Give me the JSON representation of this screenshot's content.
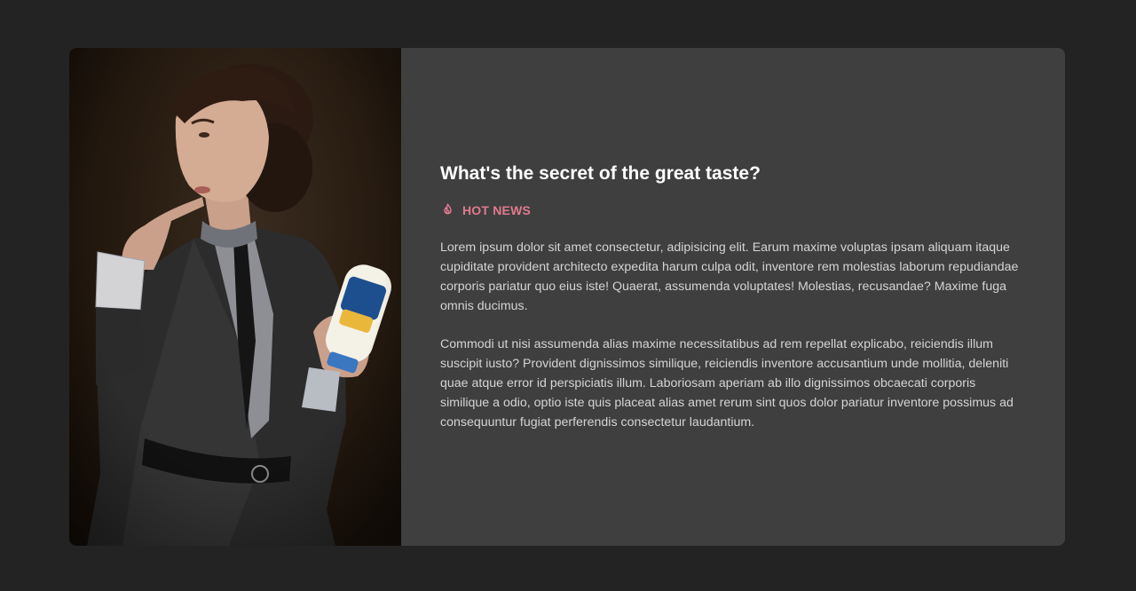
{
  "article": {
    "title": "What's the secret of the great taste?",
    "tag_label": "HOT NEWS",
    "tag_icon": "flame-icon",
    "paragraphs": [
      "Lorem ipsum dolor sit amet consectetur, adipisicing elit. Earum maxime voluptas ipsam aliquam itaque cupiditate provident architecto expedita harum culpa odit, inventore rem molestias laborum repudiandae corporis pariatur quo eius iste! Quaerat, assumenda voluptates! Molestias, recusandae? Maxime fuga omnis ducimus.",
      "Commodi ut nisi assumenda alias maxime necessitatibus ad rem repellat explicabo, reiciendis illum suscipit iusto? Provident dignissimos similique, reiciendis inventore accusantium unde mollitia, deleniti quae atque error id perspiciatis illum. Laboriosam aperiam ab illo dignissimos obcaecati corporis similique a odio, optio iste quis placeat alias amet rerum sint quos dolor pariatur inventore possimus ad consequuntur fugiat perferendis consectetur laudantium."
    ]
  },
  "colors": {
    "page_background": "#232323",
    "card_background": "#3f3f3f",
    "title": "#ffffff",
    "tag_accent": "#e07a8e",
    "body_text": "#d4d4d4"
  }
}
